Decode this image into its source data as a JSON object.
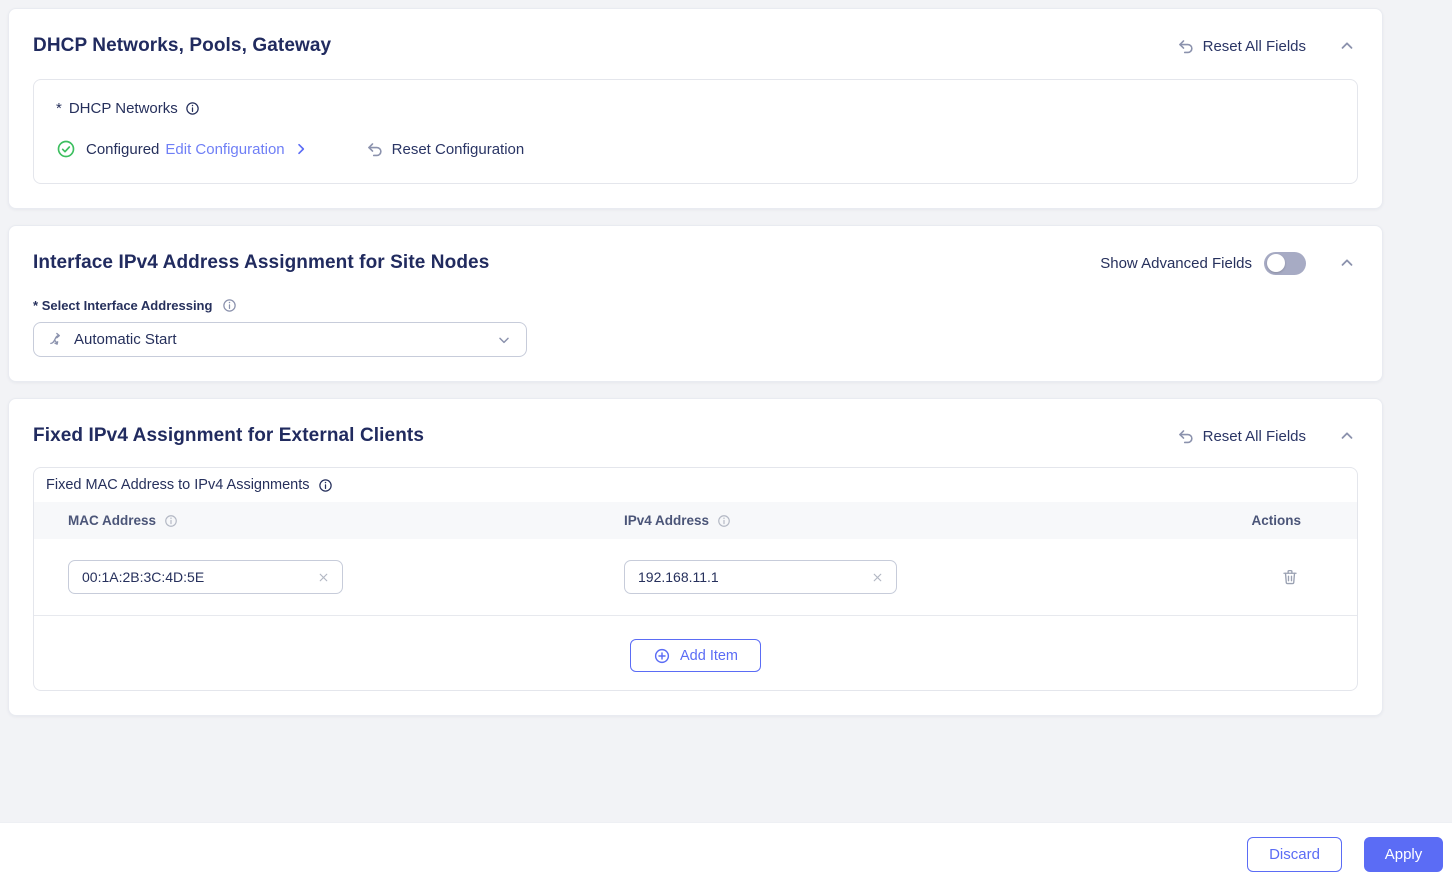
{
  "colors": {
    "accent": "#5b6cf5",
    "link": "#6f7ff6",
    "success": "#3cbf5f",
    "navy": "#212b5f",
    "icon_gray": "#8b92ad",
    "toggle_track_off": "#a7abc4",
    "table_header_bg": "#f7f8fa"
  },
  "card_dhcp": {
    "title": "DHCP Networks, Pools, Gateway",
    "reset_all": "Reset All Fields",
    "required": "*",
    "field_label": "DHCP Networks",
    "status": "Configured",
    "edit_link": "Edit Configuration",
    "reset_config": "Reset Configuration"
  },
  "card_interface": {
    "title": "Interface IPv4 Address Assignment for Site Nodes",
    "toggle_label": "Show Advanced Fields",
    "toggle_state": "off",
    "required": "*",
    "select_label": "Select Interface Addressing",
    "select_value": "Automatic Start"
  },
  "card_fixed": {
    "title": "Fixed IPv4 Assignment for External Clients",
    "reset_all": "Reset All Fields",
    "group_label": "Fixed MAC Address to IPv4 Assignments",
    "columns": {
      "mac": "MAC Address",
      "ipv4": "IPv4 Address",
      "actions": "Actions"
    },
    "rows": [
      {
        "mac": "00:1A:2B:3C:4D:5E",
        "ipv4": "192.168.11.1"
      }
    ],
    "add_item": "Add Item"
  },
  "footer": {
    "discard": "Discard",
    "apply": "Apply"
  }
}
